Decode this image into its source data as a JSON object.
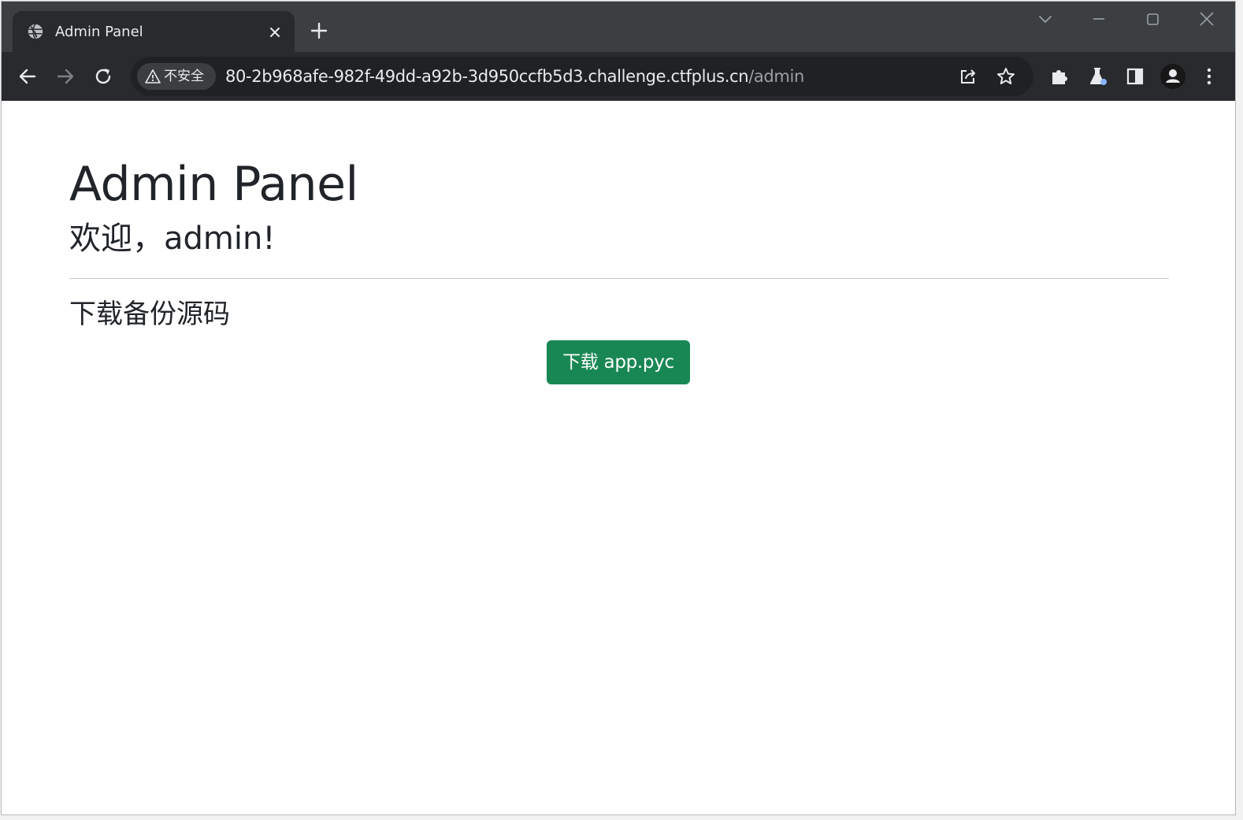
{
  "browser": {
    "tab": {
      "title": "Admin Panel",
      "favicon_icon": "globe-icon",
      "close_icon": "close-icon"
    },
    "new_tab_icon": "plus-icon",
    "window_controls": [
      "tab-search-icon",
      "minimize-icon",
      "maximize-icon",
      "close-window-icon"
    ],
    "toolbar": {
      "back_icon": "back-arrow-icon",
      "forward_icon": "forward-arrow-icon",
      "reload_icon": "reload-icon",
      "security_label": "不安全",
      "url_host": "80-2b968afe-982f-49dd-a92b-3d950ccfb5d3.challenge.ctfplus.cn",
      "url_path": "/admin",
      "share_icon": "share-icon",
      "bookmark_icon": "star-icon",
      "extensions_icon": "puzzle-icon",
      "labs_icon": "flask-icon",
      "side_panel_icon": "side-panel-icon",
      "profile_icon": "profile-icon",
      "menu_icon": "kebab-menu-icon"
    }
  },
  "page": {
    "title": "Admin Panel",
    "welcome": "欢迎，admin!",
    "section_title": "下载备份源码",
    "download_button": "下载 app.pyc",
    "button_color": "#198754"
  }
}
